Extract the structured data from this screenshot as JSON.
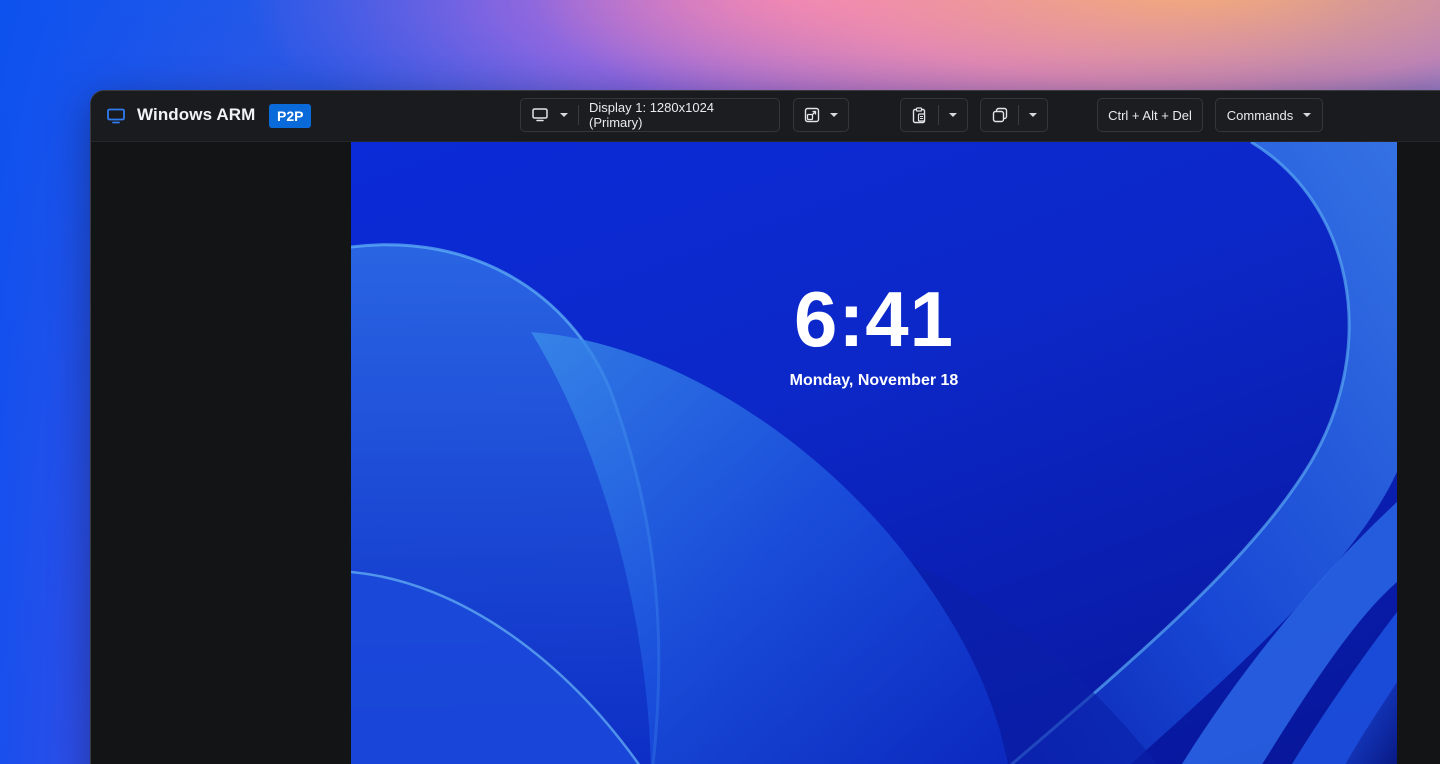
{
  "app": {
    "title": "Windows ARM",
    "connection_badge": "P2P",
    "icon": "monitor-icon"
  },
  "toolbar": {
    "display_select_icon": "monitor-icon",
    "display_label": "Display 1: 1280x1024 (Primary)",
    "scale_icon": "resize-icon",
    "clipboard_icon": "clipboard-icon",
    "copy_icon": "copy-icon",
    "ctrl_alt_del_label": "Ctrl + Alt + Del",
    "commands_label": "Commands"
  },
  "remote_screen": {
    "time": "6:41",
    "date": "Monday, November 18"
  },
  "colors": {
    "badge": "#0a6ad9",
    "titlebar": "#1a1b1e",
    "panel": "#131416"
  }
}
